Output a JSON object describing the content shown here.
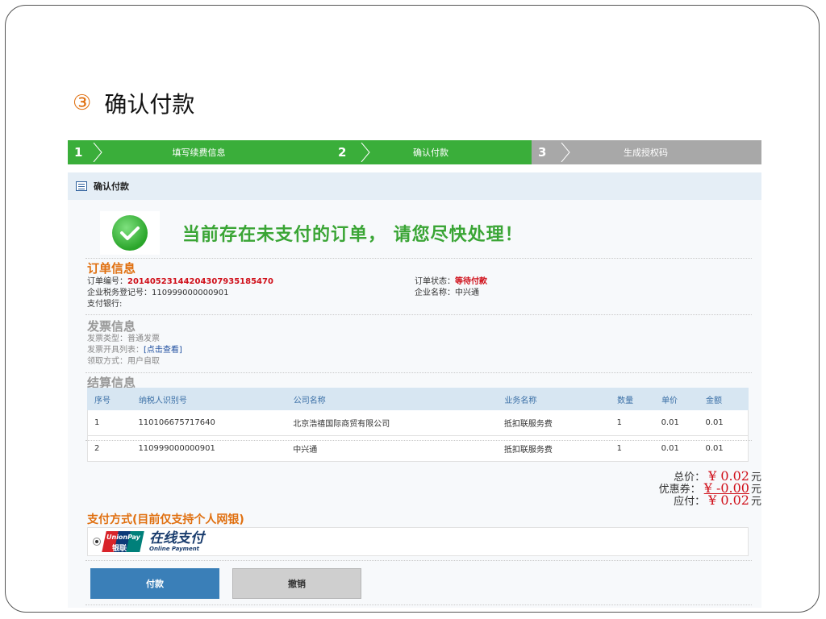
{
  "slide": {
    "number": "③",
    "title": "确认付款"
  },
  "steps": [
    {
      "num": "1",
      "label": "填写续费信息"
    },
    {
      "num": "2",
      "label": "确认付款"
    },
    {
      "num": "3",
      "label": "生成授权码"
    }
  ],
  "panel": {
    "title": "确认付款"
  },
  "notice": {
    "text": "当前存在未支付的订单， 请您尽快处理！"
  },
  "order": {
    "section_title": "订单信息",
    "no_label": "订单编号：",
    "no_value": "20140523144204307935185470",
    "tax_label": "企业税务登记号：",
    "tax_value": "110999000000901",
    "bank_label": "支付银行:",
    "status_label": "订单状态：",
    "status_value": "等待付款",
    "company_label": "企业名称：",
    "company_value": "中兴通"
  },
  "invoice": {
    "section_title": "发票信息",
    "type_label": "发票类型：",
    "type_value": "普通发票",
    "list_label": "发票开具列表：",
    "list_link": "[点击查看]",
    "pickup_label": "领取方式：",
    "pickup_value": "用户自取"
  },
  "settlement": {
    "section_title": "结算信息",
    "columns": [
      "序号",
      "纳税人识别号",
      "公司名称",
      "业务名称",
      "数量",
      "单价",
      "金额"
    ],
    "rows": [
      [
        "1",
        "110106675717640",
        "北京浩禧国际商贸有限公司",
        "抵扣联服务费",
        "1",
        "0.01",
        "0.01"
      ],
      [
        "2",
        "110999000000901",
        "中兴通",
        "抵扣联服务费",
        "1",
        "0.01",
        "0.01"
      ]
    ]
  },
  "totals": {
    "total_label": "总价：",
    "total_value": "¥ 0.02",
    "coupon_label": "优惠券：",
    "coupon_value": "¥ -0.00",
    "due_label": "应付：",
    "due_value": "¥ 0.02",
    "unit": "元"
  },
  "payment": {
    "section_title": "支付方式(目前仅支持个人网银)",
    "online_cn": "在线支付",
    "online_en": "Online Payment"
  },
  "buttons": {
    "pay": "付款",
    "cancel": "撤销"
  },
  "colors": {
    "green": "#3aae3a",
    "grey_step": "#a8a8a8",
    "red": "#d0101a",
    "orange": "#e07010",
    "blue": "#3a7fb8"
  }
}
